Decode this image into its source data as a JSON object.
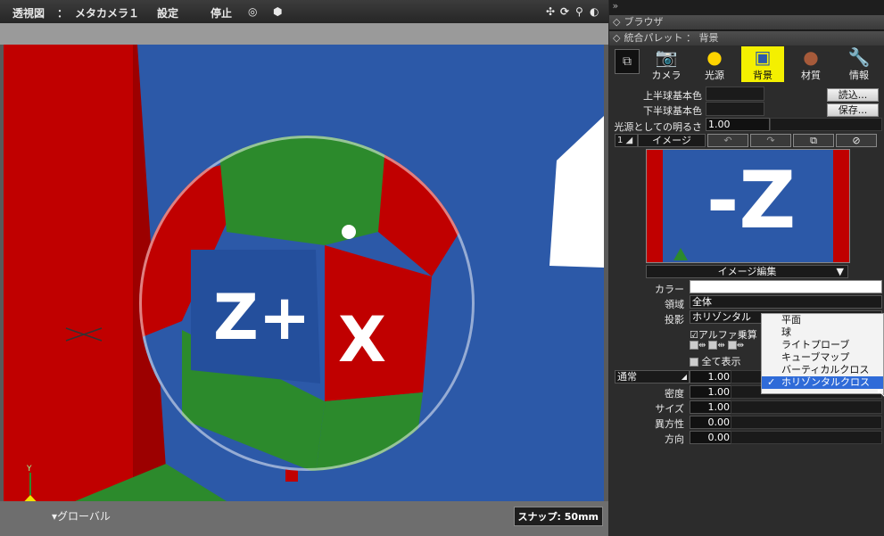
{
  "viewport": {
    "view_label": "透視図",
    "camera_label": "メタカメラ１",
    "settings_label": "設定",
    "stop_label": "停止",
    "axis_y_label": "Y",
    "global_label": "グローバル",
    "snap_label": "スナップ: 50mm"
  },
  "panel": {
    "browser_header": "ブラウザ",
    "palette_header": "統合パレット ： 背景",
    "tabs": [
      {
        "label": "カメラ",
        "icon": "camera-icon"
      },
      {
        "label": "光源",
        "icon": "light-icon"
      },
      {
        "label": "背景",
        "icon": "background-icon"
      },
      {
        "label": "材質",
        "icon": "material-icon"
      },
      {
        "label": "情報",
        "icon": "wrench-icon"
      }
    ],
    "upper_color_label": "上半球基本色",
    "lower_color_label": "下半球基本色",
    "load_button": "読込...",
    "save_button": "保存...",
    "brightness_label": "光源としての明るさ",
    "brightness_value": "1.00",
    "layer_index": "1",
    "layer_type": "イメージ",
    "preview_text": "-Z",
    "image_edit_label": "イメージ編集",
    "color_label": "カラー",
    "region_label": "領域",
    "region_value": "全体",
    "projection_label": "投影",
    "projection_value": "ホリゾンタル",
    "alpha_label": "アルファ乗算",
    "show_all_label": "全て表示",
    "blend_mode": "通常",
    "blend_value": "1.00",
    "density_label": "密度",
    "density_value": "1.00",
    "size_label": "サイズ",
    "size_value": "1.00",
    "anisotropy_label": "異方性",
    "anisotropy_value": "0.00",
    "direction_label": "方向",
    "direction_value": "0.00"
  },
  "projection_menu": {
    "items": [
      "平面",
      "球",
      "ライトプローブ",
      "キューブマップ",
      "バーティカルクロス",
      "ホリゾンタルクロス"
    ],
    "selected": "ホリゾンタルクロス",
    "check": "✓"
  },
  "colors": {
    "accent_yellow": "#f4f000",
    "menu_selected": "#2f6bd8",
    "scene_blue": "#2c59a8",
    "scene_red": "#c00000",
    "scene_green": "#2c8a2c"
  }
}
